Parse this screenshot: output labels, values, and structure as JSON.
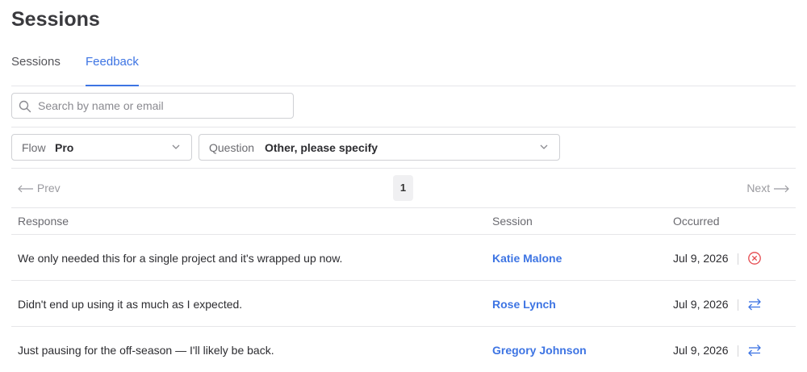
{
  "page": {
    "title": "Sessions"
  },
  "tabs": [
    {
      "label": "Sessions",
      "active": false
    },
    {
      "label": "Feedback",
      "active": true
    }
  ],
  "search": {
    "placeholder": "Search by name or email",
    "value": ""
  },
  "filters": {
    "flow": {
      "label": "Flow",
      "value": "Pro"
    },
    "question": {
      "label": "Question",
      "value": "Other, please specify"
    }
  },
  "pagination": {
    "prev_label": "Prev",
    "next_label": "Next",
    "current_page": "1"
  },
  "table": {
    "headers": {
      "response": "Response",
      "session": "Session",
      "occurred": "Occurred"
    },
    "rows": [
      {
        "response": "We only needed this for a single project and it's wrapped up now.",
        "session": "Katie Malone",
        "occurred": "Jul 9, 2026",
        "action_icon": "cancel-circle-icon"
      },
      {
        "response": "Didn't end up using it as much as I expected.",
        "session": "Rose Lynch",
        "occurred": "Jul 9, 2026",
        "action_icon": "swap-arrows-icon"
      },
      {
        "response": "Just pausing for the off-season — I'll likely be back.",
        "session": "Gregory Johnson",
        "occurred": "Jul 9, 2026",
        "action_icon": "swap-arrows-icon"
      }
    ]
  },
  "colors": {
    "accent": "#3d74e3",
    "danger": "#e5484d",
    "border": "#cfd0d4"
  }
}
